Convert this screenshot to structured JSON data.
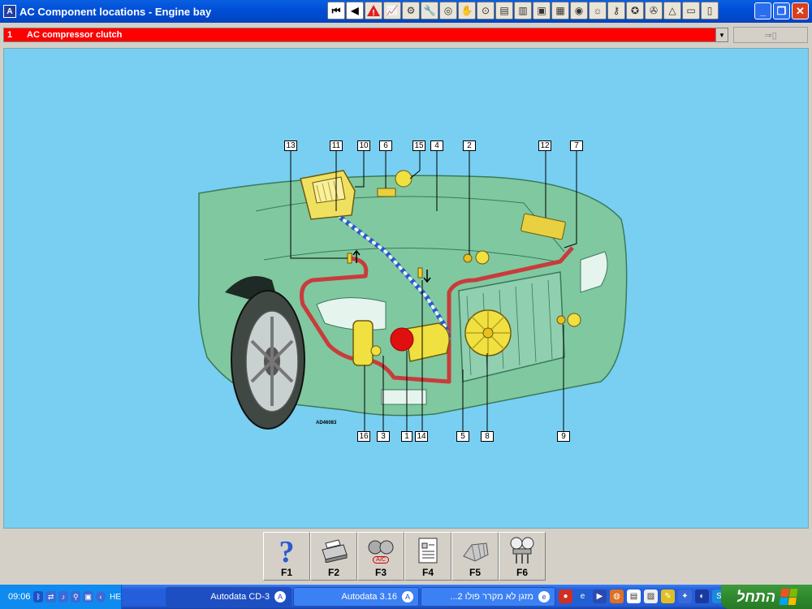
{
  "window": {
    "title": "AC Component locations - Engine bay",
    "icon": "autodata-icon"
  },
  "toolbar": {
    "icons": [
      "first-page-icon",
      "prev-page-icon",
      "warning-icon",
      "diagram-icon",
      "gear-icon",
      "tools-icon",
      "wheel-icon",
      "hand-icon",
      "tire-icon",
      "engine-icon",
      "oil-icon",
      "car-front-icon",
      "battery-icon",
      "belt-icon",
      "lamp-icon",
      "key-icon",
      "service-icon",
      "fan-icon",
      "brake-icon",
      "car-side-icon",
      "notes-icon"
    ]
  },
  "selector": {
    "number": "1",
    "value": "AC compressor clutch"
  },
  "diagram": {
    "image_code": "AD46083",
    "callouts": [
      "13",
      "11",
      "10",
      "6",
      "15",
      "4",
      "2",
      "12",
      "7",
      "9",
      "8",
      "5",
      "14",
      "1",
      "3",
      "16"
    ]
  },
  "function_keys": [
    {
      "label": "F1",
      "icon": "help-icon"
    },
    {
      "label": "F2",
      "icon": "printer-icon"
    },
    {
      "label": "F3",
      "icon": "ac-tools-icon",
      "icon_text": "A/C"
    },
    {
      "label": "F4",
      "icon": "document-icon"
    },
    {
      "label": "F5",
      "icon": "engine-block-icon"
    },
    {
      "label": "F6",
      "icon": "pressure-gauges-icon"
    }
  ],
  "taskbar": {
    "clock": "09:06",
    "lang": "HE",
    "tasks": [
      "Autodata CD-3",
      "Autodata 3.16",
      "...מזגן לא מקרר פולו 2"
    ],
    "start_label": "התחל"
  },
  "colors": {
    "diagram_bg": "#78cff2",
    "selector_bg": "#ff0000",
    "car_body": "#80c8a0",
    "refrigerant_line": "#c83c3c"
  }
}
